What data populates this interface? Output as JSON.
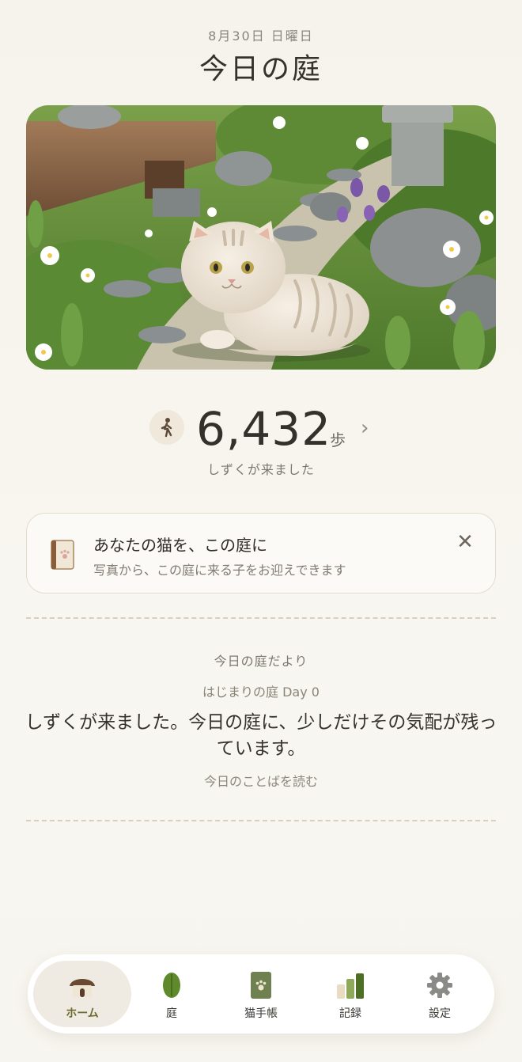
{
  "header": {
    "date": "8月30日 日曜日",
    "title": "今日の庭"
  },
  "steps": {
    "icon": "walking-person-icon",
    "count": "6,432",
    "unit": "歩",
    "caption": "しずくが来ました"
  },
  "invite_card": {
    "icon": "cat-notebook-icon",
    "title": "あなたの猫を、この庭に",
    "subtitle": "写真から、この庭に来る子をお迎えできます",
    "close_icon": "close-icon"
  },
  "garden_news": {
    "heading": "今日の庭だより",
    "day_label": "はじまりの庭 Day 0",
    "body": "しずくが来ました。今日の庭に、少しだけその気配が残っています。",
    "link": "今日のことばを読む"
  },
  "tabs": [
    {
      "label": "ホーム",
      "icon": "house-icon",
      "active": true
    },
    {
      "label": "庭",
      "icon": "leaf-icon",
      "active": false
    },
    {
      "label": "猫手帳",
      "icon": "cat-notebook-icon",
      "active": false
    },
    {
      "label": "記録",
      "icon": "bar-chart-icon",
      "active": false
    },
    {
      "label": "設定",
      "icon": "gear-icon",
      "active": false
    }
  ],
  "colors": {
    "background": "#f7f5ef",
    "accent": "#6d6a32",
    "card_border": "#e3dccd"
  }
}
